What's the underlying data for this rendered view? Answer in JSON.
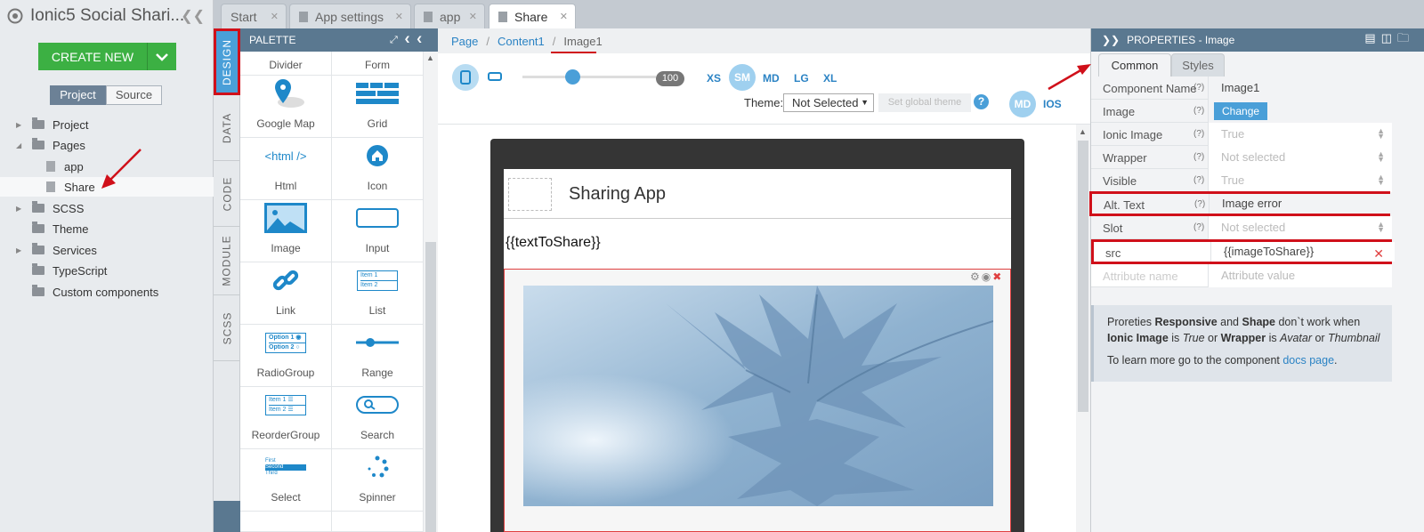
{
  "project": {
    "title": "Ionic5 Social Shari...",
    "create_label": "CREATE NEW",
    "toggle": {
      "project": "Project",
      "source": "Source"
    },
    "tree": [
      {
        "label": "Project"
      },
      {
        "label": "Pages"
      },
      {
        "label": "app"
      },
      {
        "label": "Share"
      },
      {
        "label": "SCSS"
      },
      {
        "label": "Theme"
      },
      {
        "label": "Services"
      },
      {
        "label": "TypeScript"
      },
      {
        "label": "Custom components"
      }
    ]
  },
  "tabs": [
    "Start",
    "App settings",
    "app",
    "Share"
  ],
  "side_tabs": [
    "DESIGN",
    "DATA",
    "CODE",
    "MODULE",
    "SCSS"
  ],
  "palette": {
    "title": "PALETTE",
    "items": [
      "Divider",
      "Form",
      "Google Map",
      "Grid",
      "Html",
      "Icon",
      "Image",
      "Input",
      "Link",
      "List",
      "RadioGroup",
      "Range",
      "ReorderGroup",
      "Search",
      "Select",
      "Spinner"
    ],
    "html_glyph": "<html />",
    "list_glyph": [
      "Item 1",
      "Item 2"
    ],
    "radio_glyph": [
      "Option 1",
      "Option 2"
    ],
    "reorder_glyph": [
      "Item 1",
      "Item 2"
    ],
    "select_glyph": [
      "First",
      "Second",
      "Third"
    ]
  },
  "breadcrumb": {
    "page": "Page",
    "content": "Content1",
    "current": "Image1",
    "sep": "/"
  },
  "toolbar": {
    "zoom": "100",
    "sizes": [
      "XS",
      "SM",
      "MD",
      "LG",
      "XL"
    ],
    "theme_label": "Theme:",
    "theme_value": "Not Selected",
    "global_theme": "Set global theme",
    "help": "?",
    "platform_md": "MD",
    "platform_ios": "IOS"
  },
  "preview": {
    "header_title": "Sharing App",
    "text": "{{textToShare}}"
  },
  "properties": {
    "title": "PROPERTIES - Image",
    "tab_common": "Common",
    "tab_styles": "Styles",
    "help": "(?)",
    "rows": [
      {
        "key": "Component Name",
        "value": "Image1"
      },
      {
        "key": "Image",
        "value": "Change"
      },
      {
        "key": "Ionic Image",
        "value": "True"
      },
      {
        "key": "Wrapper",
        "value": "Not selected"
      },
      {
        "key": "Visible",
        "value": "True"
      },
      {
        "key": "Alt. Text",
        "value": "Image error"
      },
      {
        "key": "Slot",
        "value": "Not selected"
      },
      {
        "key": "src",
        "value": "{{imageToShare}}"
      },
      {
        "key": "Attribute name",
        "value": "Attribute value"
      }
    ],
    "note": {
      "t1": "Proreties ",
      "b1": "Responsive",
      "t2": " and ",
      "b2": "Shape",
      "t3": " don`t work when",
      "b3": "Ionic Image",
      "t4": " is ",
      "i1": "True",
      "t5": " or ",
      "b4": "Wrapper",
      "t6": " is ",
      "i2": "Avatar",
      "t7": " or ",
      "i3": "Thumbnail",
      "l2a": "To learn more go to the component ",
      "link": "docs page",
      "l2b": "."
    }
  },
  "colors": {
    "accent": "#4a9fd8",
    "create": "#3cb043",
    "highlight": "#d0101a",
    "header": "#5a7890"
  }
}
